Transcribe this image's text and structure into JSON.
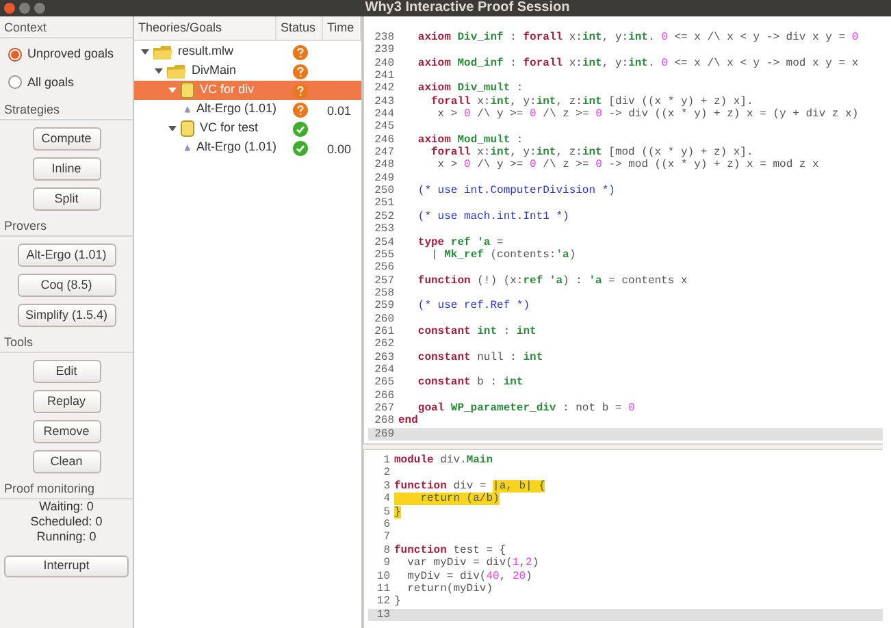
{
  "window": {
    "title": "Why3 Interactive Proof Session"
  },
  "context": {
    "title": "Context",
    "options": [
      {
        "label": "Unproved goals",
        "selected": true
      },
      {
        "label": "All goals",
        "selected": false
      }
    ]
  },
  "strategies": {
    "title": "Strategies",
    "buttons": [
      "Compute",
      "Inline",
      "Split"
    ]
  },
  "provers": {
    "title": "Provers",
    "buttons": [
      "Alt-Ergo (1.01)",
      "Coq (8.5)",
      "Simplify (1.5.4)"
    ]
  },
  "tools": {
    "title": "Tools",
    "buttons": [
      "Edit",
      "Replay",
      "Remove",
      "Clean"
    ]
  },
  "monitoring": {
    "title": "Proof monitoring",
    "lines": [
      "Waiting: 0",
      "Scheduled: 0",
      "Running: 0"
    ],
    "button": "Interrupt"
  },
  "tree": {
    "columns": [
      "Theories/Goals",
      "Status",
      "Time"
    ],
    "rows": [
      {
        "label": "result.mlw",
        "kind": "folder",
        "proved": false,
        "expanded": true,
        "selected": false,
        "children": [
          {
            "label": "DivMain",
            "kind": "folder",
            "proved": false,
            "expanded": true,
            "selected": false,
            "children": [
              {
                "label": "VC for div",
                "kind": "goal",
                "proved": false,
                "expanded": true,
                "selected": true,
                "children": [
                  {
                    "label": "Alt-Ergo (1.01)",
                    "kind": "prover",
                    "proved": false,
                    "time": "0.01",
                    "selected": false
                  }
                ]
              },
              {
                "label": "VC for test",
                "kind": "goal",
                "proved": true,
                "expanded": true,
                "selected": false,
                "children": [
                  {
                    "label": "Alt-Ergo (1.01)",
                    "kind": "prover",
                    "proved": true,
                    "time": "0.00",
                    "selected": false
                  }
                ]
              }
            ]
          }
        ]
      }
    ]
  },
  "task_view": {
    "lines": [
      {
        "number": "238",
        "current": false,
        "tokens": [
          {
            "text": "   axiom ",
            "kind": "keyword"
          },
          {
            "text": "Div_inf",
            "kind": "name"
          },
          {
            "text": " : ",
            "kind": "plain"
          },
          {
            "text": "forall",
            "kind": "keyword"
          },
          {
            "text": " x:",
            "kind": "plain"
          },
          {
            "text": "int",
            "kind": "type"
          },
          {
            "text": ", y:",
            "kind": "plain"
          },
          {
            "text": "int",
            "kind": "type"
          },
          {
            "text": ". ",
            "kind": "plain"
          },
          {
            "text": "0",
            "kind": "number"
          },
          {
            "text": " <= x /\\ x < y -> div x y = ",
            "kind": "plain"
          },
          {
            "text": "0",
            "kind": "number"
          }
        ]
      },
      {
        "number": "239",
        "current": false
      },
      {
        "number": "240",
        "current": false,
        "tokens": [
          {
            "text": "   axiom ",
            "kind": "keyword"
          },
          {
            "text": "Mod_inf",
            "kind": "name"
          },
          {
            "text": " : ",
            "kind": "plain"
          },
          {
            "text": "forall",
            "kind": "keyword"
          },
          {
            "text": " x:",
            "kind": "plain"
          },
          {
            "text": "int",
            "kind": "type"
          },
          {
            "text": ", y:",
            "kind": "plain"
          },
          {
            "text": "int",
            "kind": "type"
          },
          {
            "text": ". ",
            "kind": "plain"
          },
          {
            "text": "0",
            "kind": "number"
          },
          {
            "text": " <= x /\\ x < y -> mod x y = x",
            "kind": "plain"
          }
        ]
      },
      {
        "number": "241",
        "current": false
      },
      {
        "number": "242",
        "current": false,
        "tokens": [
          {
            "text": "   axiom ",
            "kind": "keyword"
          },
          {
            "text": "Div_mult",
            "kind": "name"
          },
          {
            "text": " :",
            "kind": "plain"
          }
        ]
      },
      {
        "number": "243",
        "current": false,
        "tokens": [
          {
            "text": "     forall",
            "kind": "keyword"
          },
          {
            "text": " x:",
            "kind": "plain"
          },
          {
            "text": "int",
            "kind": "type"
          },
          {
            "text": ", y:",
            "kind": "plain"
          },
          {
            "text": "int",
            "kind": "type"
          },
          {
            "text": ", z:",
            "kind": "plain"
          },
          {
            "text": "int",
            "kind": "type"
          },
          {
            "text": " [div ((x * y) + z) x].",
            "kind": "plain"
          }
        ]
      },
      {
        "number": "244",
        "current": false,
        "tokens": [
          {
            "text": "      x > ",
            "kind": "plain"
          },
          {
            "text": "0",
            "kind": "number"
          },
          {
            "text": " /\\ y >= ",
            "kind": "plain"
          },
          {
            "text": "0",
            "kind": "number"
          },
          {
            "text": " /\\ z >= ",
            "kind": "plain"
          },
          {
            "text": "0",
            "kind": "number"
          },
          {
            "text": " -> div ((x * y) + z) x = (y + div z x)",
            "kind": "plain"
          }
        ]
      },
      {
        "number": "245",
        "current": false
      },
      {
        "number": "246",
        "current": false,
        "tokens": [
          {
            "text": "   axiom ",
            "kind": "keyword"
          },
          {
            "text": "Mod_mult",
            "kind": "name"
          },
          {
            "text": " :",
            "kind": "plain"
          }
        ]
      },
      {
        "number": "247",
        "current": false,
        "tokens": [
          {
            "text": "     forall",
            "kind": "keyword"
          },
          {
            "text": " x:",
            "kind": "plain"
          },
          {
            "text": "int",
            "kind": "type"
          },
          {
            "text": ", y:",
            "kind": "plain"
          },
          {
            "text": "int",
            "kind": "type"
          },
          {
            "text": ", z:",
            "kind": "plain"
          },
          {
            "text": "int",
            "kind": "type"
          },
          {
            "text": " [mod ((x * y) + z) x].",
            "kind": "plain"
          }
        ]
      },
      {
        "number": "248",
        "current": false,
        "tokens": [
          {
            "text": "      x > ",
            "kind": "plain"
          },
          {
            "text": "0",
            "kind": "number"
          },
          {
            "text": " /\\ y >= ",
            "kind": "plain"
          },
          {
            "text": "0",
            "kind": "number"
          },
          {
            "text": " /\\ z >= ",
            "kind": "plain"
          },
          {
            "text": "0",
            "kind": "number"
          },
          {
            "text": " -> mod ((x * y) + z) x = mod z x",
            "kind": "plain"
          }
        ]
      },
      {
        "number": "249",
        "current": false
      },
      {
        "number": "250",
        "current": false,
        "tokens": [
          {
            "text": "   (* use int.ComputerDivision *)",
            "kind": "comment"
          }
        ]
      },
      {
        "number": "251",
        "current": false
      },
      {
        "number": "252",
        "current": false,
        "tokens": [
          {
            "text": "   (* use mach.int.Int1 *)",
            "kind": "comment"
          }
        ]
      },
      {
        "number": "253",
        "current": false
      },
      {
        "number": "254",
        "current": false,
        "tokens": [
          {
            "text": "   type ",
            "kind": "keyword"
          },
          {
            "text": "ref 'a",
            "kind": "type"
          },
          {
            "text": " =",
            "kind": "plain"
          }
        ]
      },
      {
        "number": "255",
        "current": false,
        "tokens": [
          {
            "text": "     | ",
            "kind": "plain"
          },
          {
            "text": "Mk_ref",
            "kind": "name"
          },
          {
            "text": " (contents:",
            "kind": "plain"
          },
          {
            "text": "'a",
            "kind": "type"
          },
          {
            "text": ")",
            "kind": "plain"
          }
        ]
      },
      {
        "number": "256",
        "current": false
      },
      {
        "number": "257",
        "current": false,
        "tokens": [
          {
            "text": "   function ",
            "kind": "keyword"
          },
          {
            "text": "(!) (x:",
            "kind": "plain"
          },
          {
            "text": "ref 'a",
            "kind": "type"
          },
          {
            "text": ") : ",
            "kind": "plain"
          },
          {
            "text": "'a",
            "kind": "type"
          },
          {
            "text": " = contents x",
            "kind": "plain"
          }
        ]
      },
      {
        "number": "258",
        "current": false
      },
      {
        "number": "259",
        "current": false,
        "tokens": [
          {
            "text": "   (* use ref.Ref *)",
            "kind": "comment"
          }
        ]
      },
      {
        "number": "260",
        "current": false
      },
      {
        "number": "261",
        "current": false,
        "tokens": [
          {
            "text": "   constant ",
            "kind": "keyword"
          },
          {
            "text": "int",
            "kind": "type"
          },
          {
            "text": " : ",
            "kind": "plain"
          },
          {
            "text": "int",
            "kind": "type"
          }
        ]
      },
      {
        "number": "262",
        "current": false
      },
      {
        "number": "263",
        "current": false,
        "tokens": [
          {
            "text": "   constant ",
            "kind": "keyword"
          },
          {
            "text": "null : ",
            "kind": "plain"
          },
          {
            "text": "int",
            "kind": "type"
          }
        ]
      },
      {
        "number": "264",
        "current": false
      },
      {
        "number": "265",
        "current": false,
        "tokens": [
          {
            "text": "   constant ",
            "kind": "keyword"
          },
          {
            "text": "b : ",
            "kind": "plain"
          },
          {
            "text": "int",
            "kind": "type"
          }
        ]
      },
      {
        "number": "266",
        "current": false
      },
      {
        "number": "267",
        "current": false,
        "tokens": [
          {
            "text": "   goal ",
            "kind": "keyword"
          },
          {
            "text": "WP_parameter_div",
            "kind": "name"
          },
          {
            "text": " : not b = ",
            "kind": "plain"
          },
          {
            "text": "0",
            "kind": "number"
          }
        ]
      },
      {
        "number": "268",
        "current": false,
        "tokens": [
          {
            "text": "end",
            "kind": "keyword"
          }
        ]
      },
      {
        "number": "269",
        "current": true
      }
    ]
  },
  "source_view": {
    "lines": [
      {
        "number": "1",
        "current": false,
        "tokens": [
          {
            "text": "module ",
            "kind": "keyword",
            "highlighted": false
          },
          {
            "text": "div.",
            "kind": "plain",
            "highlighted": false
          },
          {
            "text": "Main",
            "kind": "name",
            "highlighted": false
          }
        ]
      },
      {
        "number": "2",
        "current": false
      },
      {
        "number": "3",
        "current": false,
        "tokens": [
          {
            "text": "function ",
            "kind": "keyword",
            "highlighted": false
          },
          {
            "text": "div = ",
            "kind": "plain",
            "highlighted": false
          },
          {
            "text": "|a, b| {",
            "kind": "plain",
            "highlighted": true
          }
        ]
      },
      {
        "number": "4",
        "current": false,
        "tokens": [
          {
            "text": "    return (a/b)",
            "kind": "plain",
            "highlighted": true
          }
        ]
      },
      {
        "number": "5",
        "current": false,
        "tokens": [
          {
            "text": "}",
            "kind": "plain",
            "highlighted": true
          }
        ]
      },
      {
        "number": "6",
        "current": false
      },
      {
        "number": "7",
        "current": false
      },
      {
        "number": "8",
        "current": false,
        "tokens": [
          {
            "text": "function ",
            "kind": "keyword",
            "highlighted": false
          },
          {
            "text": "test = {",
            "kind": "plain",
            "highlighted": false
          }
        ]
      },
      {
        "number": "9",
        "current": false,
        "tokens": [
          {
            "text": "  var myDiv = div(",
            "kind": "plain",
            "highlighted": false
          },
          {
            "text": "1",
            "kind": "number",
            "highlighted": false
          },
          {
            "text": ",",
            "kind": "plain",
            "highlighted": false
          },
          {
            "text": "2",
            "kind": "number",
            "highlighted": false
          },
          {
            "text": ")",
            "kind": "plain",
            "highlighted": false
          }
        ]
      },
      {
        "number": "10",
        "current": false,
        "tokens": [
          {
            "text": "  myDiv = div(",
            "kind": "plain",
            "highlighted": false
          },
          {
            "text": "40",
            "kind": "number",
            "highlighted": false
          },
          {
            "text": ", ",
            "kind": "plain",
            "highlighted": false
          },
          {
            "text": "20",
            "kind": "number",
            "highlighted": false
          },
          {
            "text": ")",
            "kind": "plain",
            "highlighted": false
          }
        ]
      },
      {
        "number": "11",
        "current": false,
        "tokens": [
          {
            "text": "  return(myDiv)",
            "kind": "plain",
            "highlighted": false
          }
        ]
      },
      {
        "number": "12",
        "current": false,
        "tokens": [
          {
            "text": "}",
            "kind": "plain",
            "highlighted": false
          }
        ]
      },
      {
        "number": "13",
        "current": true
      }
    ]
  }
}
